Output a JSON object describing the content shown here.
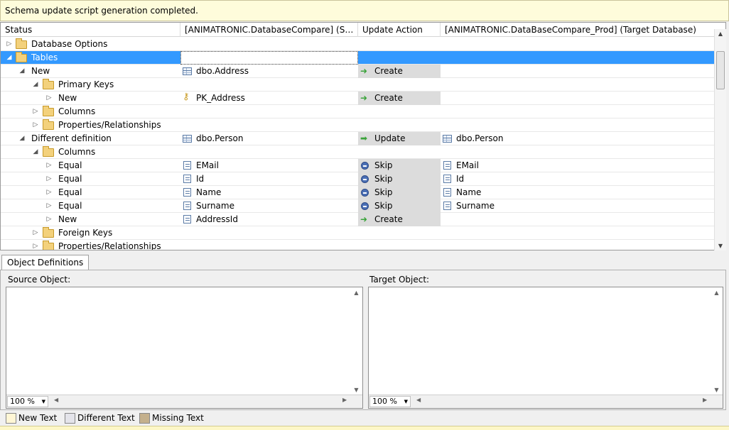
{
  "info_message": "Schema update script generation completed.",
  "columns": {
    "status": "Status",
    "source": "[ANIMATRONIC.DatabaseCompare] (Sourc...",
    "action": "Update Action",
    "target": "[ANIMATRONIC.DataBaseCompare_Prod] (Target Database)"
  },
  "rows": [
    {
      "status": "Database Options",
      "source": "",
      "action": "",
      "target": ""
    },
    {
      "status": "Tables",
      "source": "",
      "action": "",
      "target": ""
    },
    {
      "status": "New",
      "source": "dbo.Address",
      "action": "Create",
      "target": ""
    },
    {
      "status": "Primary Keys",
      "source": "",
      "action": "",
      "target": ""
    },
    {
      "status": "New",
      "source": "PK_Address",
      "action": "Create",
      "target": ""
    },
    {
      "status": "Columns",
      "source": "",
      "action": "",
      "target": ""
    },
    {
      "status": "Properties/Relationships",
      "source": "",
      "action": "",
      "target": ""
    },
    {
      "status": "Different definition",
      "source": "dbo.Person",
      "action": "Update",
      "target": "dbo.Person"
    },
    {
      "status": "Columns",
      "source": "",
      "action": "",
      "target": ""
    },
    {
      "status": "Equal",
      "source": "EMail",
      "action": "Skip",
      "target": "EMail"
    },
    {
      "status": "Equal",
      "source": "Id",
      "action": "Skip",
      "target": "Id"
    },
    {
      "status": "Equal",
      "source": "Name",
      "action": "Skip",
      "target": "Name"
    },
    {
      "status": "Equal",
      "source": "Surname",
      "action": "Skip",
      "target": "Surname"
    },
    {
      "status": "New",
      "source": "AddressId",
      "action": "Create",
      "target": ""
    },
    {
      "status": "Foreign Keys",
      "source": "",
      "action": "",
      "target": ""
    },
    {
      "status": "Properties/Relationships",
      "source": "",
      "action": "",
      "target": ""
    }
  ],
  "tab_label": "Object Definitions",
  "source_object_label": "Source Object:",
  "target_object_label": "Target Object:",
  "zoom_source": "100 %",
  "zoom_target": "100 %",
  "legend": {
    "new_text": "New Text",
    "different_text": "Different Text",
    "missing_text": "Missing Text"
  },
  "colors": {
    "selection": "#3399ff",
    "new_text": "#fff6d5",
    "different_text": "#e4e4ea",
    "missing_text": "#c4b08c",
    "info_bar": "#fefcdb"
  }
}
